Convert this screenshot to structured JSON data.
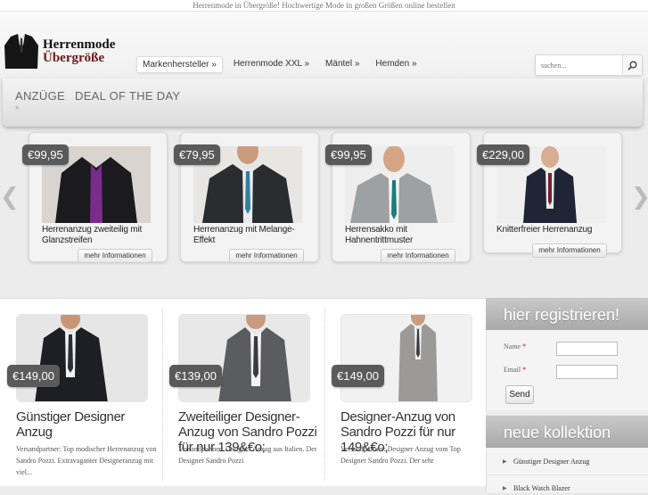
{
  "topbar": {
    "text": "Herrenmode in Übergröße! Hochwertige Mode in großen Größen online bestellen"
  },
  "logo": {
    "line1": "Herrenmode",
    "line2": "Übergröße"
  },
  "nav": [
    {
      "label": "Markenhersteller »"
    },
    {
      "label": "Herrenmode XXL »"
    },
    {
      "label": "Mäntel »"
    },
    {
      "label": "Hemden »"
    }
  ],
  "search": {
    "placeholder": "suchen..."
  },
  "categories": [
    {
      "label": "ANZÜGE"
    },
    {
      "label": "DEAL OF THE DAY"
    }
  ],
  "categories_arrow": "»",
  "carousel": {
    "prev_glyph": "❮",
    "next_glyph": "❯",
    "button_label": "mehr Informationen",
    "items": [
      {
        "price": "€99,95",
        "title": "Herrenanzug zweiteilig mit Glanzstreifen"
      },
      {
        "price": "€79,95",
        "title": "Herrenanzug mit Melange-Effekt"
      },
      {
        "price": "€99,95",
        "title": "Herrensakko mit Hahnentrittmuster"
      },
      {
        "price": "€229,00",
        "title": "Knitterfreier Herrenanzug"
      }
    ]
  },
  "products": [
    {
      "price": "€149,00",
      "title": "Günstiger Designer Anzug",
      "desc": "Versandpartner:     Top modischer Herrenanzug von Sandro Pozzi. Extravaganter Designeranzug mit viel..."
    },
    {
      "price": "€139,00",
      "title": "Zweiteiliger Designer-Anzug von Sandro Pozzi für nur 139&€o;",
      "desc": "Versandpartner:     Designer Anzug aus Italien. Der Designer Sandro Pozzi"
    },
    {
      "price": "€149,00",
      "title": "Designer-Anzug von Sandro Pozzi für nur 149&€o;",
      "desc": "Versandpartner:     Designer Anzug vom Top Designer Sandro Pozzi. Der sehr"
    }
  ],
  "sidebar": {
    "register_title": "hier registrieren!",
    "name_label": "Name",
    "email_label": "Email",
    "required_mark": "*",
    "send_label": "Send",
    "collection_title": "neue kollektion",
    "collection_items": [
      {
        "label": "Günstiger Designer Anzug"
      },
      {
        "label": "Black Watch Blazer"
      }
    ]
  }
}
